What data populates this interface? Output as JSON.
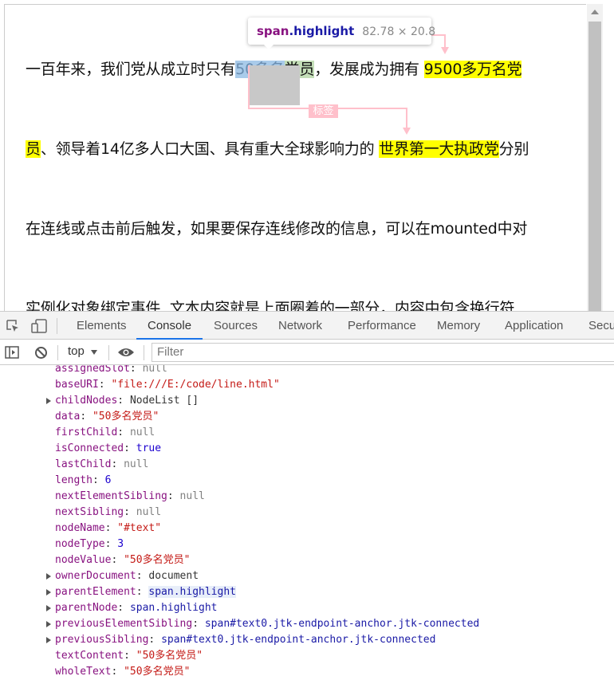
{
  "page": {
    "line1": {
      "before": "一百年来，我们党从成立时只有",
      "inspected_a": "50多名",
      "inspected_b": "党员",
      "after": "，发展成为拥有 ",
      "highlight": "9500多万名党"
    },
    "line2": {
      "highlight_start": "员",
      "middle": "、领导着14亿多人口大国、具有重大全球影响力的 ",
      "highlight": "世界第一大执政党",
      "after": "分别"
    },
    "line3": "在连线或点击前后触发，如果要保存连线修改的信息，可以在mounted中对",
    "line4": "实例化对象绑定事件, 文本内容就是上面圈着的一部分，内容中包含换行符",
    "label_tag": "标签"
  },
  "tooltip": {
    "tag": "span",
    "cls": ".highlight",
    "dims": "82.78 × 20.8"
  },
  "devtools": {
    "tabs": [
      "Elements",
      "Console",
      "Sources",
      "Network",
      "Performance",
      "Memory",
      "Application",
      "Secu"
    ],
    "active_tab": "Console",
    "context": "top",
    "filter_placeholder": "Filter"
  },
  "console": {
    "props": [
      {
        "key": "assignedSlot",
        "value": "null",
        "type": "nul",
        "expandable": false
      },
      {
        "key": "baseURI",
        "value": "\"file:///E:/code/line.html\"",
        "type": "str",
        "expandable": false
      },
      {
        "key": "childNodes",
        "value": "NodeList []",
        "type": "p",
        "expandable": true
      },
      {
        "key": "data",
        "value": "\"50多名党员\"",
        "type": "str",
        "expandable": false
      },
      {
        "key": "firstChild",
        "value": "null",
        "type": "nul",
        "expandable": false
      },
      {
        "key": "isConnected",
        "value": "true",
        "type": "kw",
        "expandable": false
      },
      {
        "key": "lastChild",
        "value": "null",
        "type": "nul",
        "expandable": false
      },
      {
        "key": "length",
        "value": "6",
        "type": "num",
        "expandable": false
      },
      {
        "key": "nextElementSibling",
        "value": "null",
        "type": "nul",
        "expandable": false
      },
      {
        "key": "nextSibling",
        "value": "null",
        "type": "nul",
        "expandable": false
      },
      {
        "key": "nodeName",
        "value": "\"#text\"",
        "type": "str",
        "expandable": false
      },
      {
        "key": "nodeType",
        "value": "3",
        "type": "num",
        "expandable": false
      },
      {
        "key": "nodeValue",
        "value": "\"50多名党员\"",
        "type": "str",
        "expandable": false
      },
      {
        "key": "ownerDocument",
        "value": "document",
        "type": "p",
        "expandable": true
      },
      {
        "key": "parentElement",
        "value": "span.highlight",
        "type": "objh",
        "expandable": true
      },
      {
        "key": "parentNode",
        "value": "span.highlight",
        "type": "obj",
        "expandable": true
      },
      {
        "key": "previousElementSibling",
        "value": "span#text0.jtk-endpoint-anchor.jtk-connected",
        "type": "obj",
        "expandable": true
      },
      {
        "key": "previousSibling",
        "value": "span#text0.jtk-endpoint-anchor.jtk-connected",
        "type": "obj",
        "expandable": true
      },
      {
        "key": "textContent",
        "value": "\"50多名党员\"",
        "type": "str",
        "expandable": false
      },
      {
        "key": "wholeText",
        "value": "\"50多名党员\"",
        "type": "str",
        "expandable": false
      }
    ]
  },
  "colors": {
    "highlight": "#ffff00",
    "connector": "#ffc0cb",
    "active_tab_underline": "#1a73e8"
  }
}
